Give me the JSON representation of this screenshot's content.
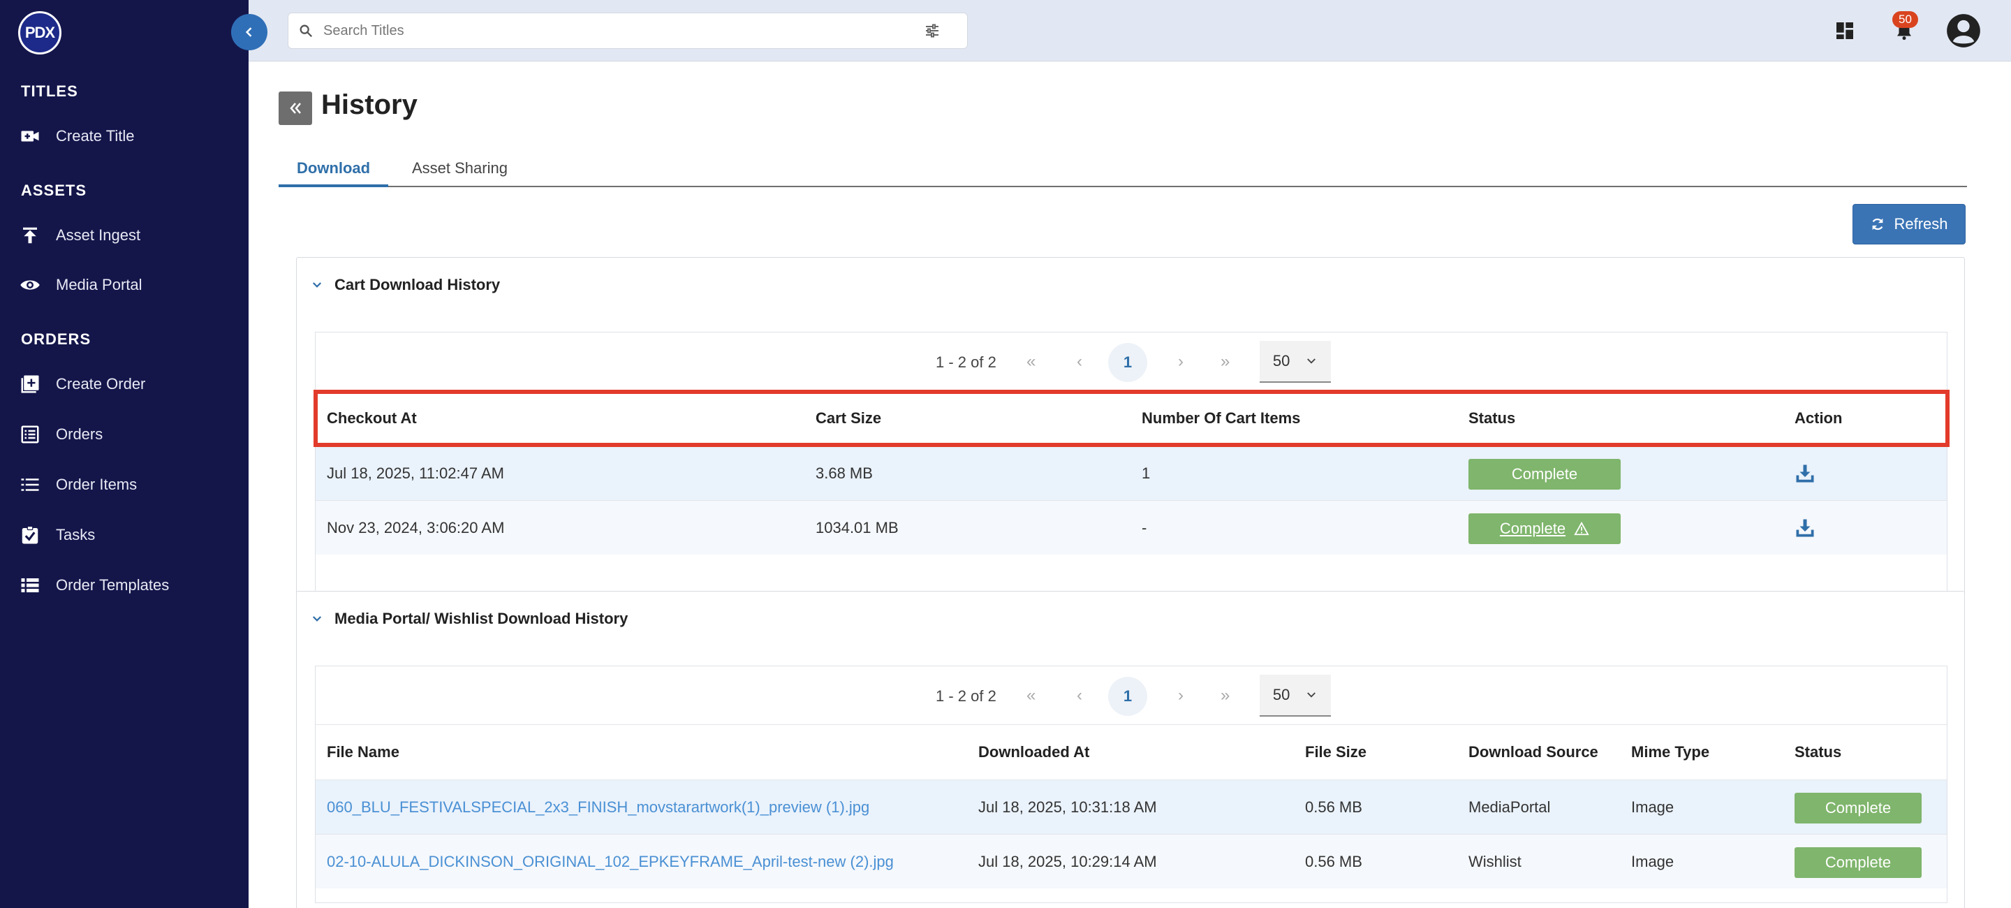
{
  "app": {
    "logo_text": "PDX"
  },
  "sidebar": {
    "sections": [
      {
        "label": "TITLES"
      },
      {
        "label": "ASSETS"
      },
      {
        "label": "ORDERS"
      }
    ],
    "items": [
      {
        "label": "Create Title",
        "icon": "video-plus-icon"
      },
      {
        "label": "Asset Ingest",
        "icon": "upload-icon"
      },
      {
        "label": "Media Portal",
        "icon": "eye-icon"
      },
      {
        "label": "Create Order",
        "icon": "plus-square-icon"
      },
      {
        "label": "Orders",
        "icon": "list-box-icon"
      },
      {
        "label": "Order Items",
        "icon": "list-icon"
      },
      {
        "label": "Tasks",
        "icon": "checkbox-icon"
      },
      {
        "label": "Order Templates",
        "icon": "table-icon"
      }
    ]
  },
  "topbar": {
    "search_placeholder": "Search Titles",
    "notification_count": "50"
  },
  "page": {
    "title": "History",
    "tabs": [
      {
        "label": "Download",
        "active": true
      },
      {
        "label": "Asset Sharing",
        "active": false
      }
    ],
    "refresh_label": "Refresh"
  },
  "cart_history": {
    "title": "Cart Download History",
    "pager": {
      "count": "1 - 2 of 2",
      "page": "1",
      "page_size": "50"
    },
    "columns": [
      "Checkout At",
      "Cart Size",
      "Number Of Cart Items",
      "Status",
      "Action"
    ],
    "rows": [
      {
        "checkout_at": "Jul 18, 2025, 11:02:47 AM",
        "cart_size": "3.68 MB",
        "items": "1",
        "status": "Complete",
        "warning": false
      },
      {
        "checkout_at": "Nov 23, 2024, 3:06:20 AM",
        "cart_size": "1034.01 MB",
        "items": "-",
        "status": "Complete",
        "warning": true
      }
    ]
  },
  "media_history": {
    "title": "Media Portal/ Wishlist Download History",
    "pager": {
      "count": "1 - 2 of 2",
      "page": "1",
      "page_size": "50"
    },
    "columns": [
      "File Name",
      "Downloaded At",
      "File Size",
      "Download Source",
      "Mime Type",
      "Status"
    ],
    "rows": [
      {
        "file_name": "060_BLU_FESTIVALSPECIAL_2x3_FINISH_movstarartwork(1)_preview (1).jpg",
        "downloaded_at": "Jul 18, 2025, 10:31:18 AM",
        "file_size": "0.56 MB",
        "source": "MediaPortal",
        "mime": "Image",
        "status": "Complete"
      },
      {
        "file_name": "02-10-ALULA_DICKINSON_ORIGINAL_102_EPKEYFRAME_April-test-new (2).jpg",
        "downloaded_at": "Jul 18, 2025, 10:29:14 AM",
        "file_size": "0.56 MB",
        "source": "Wishlist",
        "mime": "Image",
        "status": "Complete"
      }
    ]
  },
  "colors": {
    "sidebar_bg": "#14164a",
    "accent": "#3a74b5",
    "status_complete": "#7fb56c",
    "highlight": "#e23b2b",
    "link": "#4a90d4"
  }
}
